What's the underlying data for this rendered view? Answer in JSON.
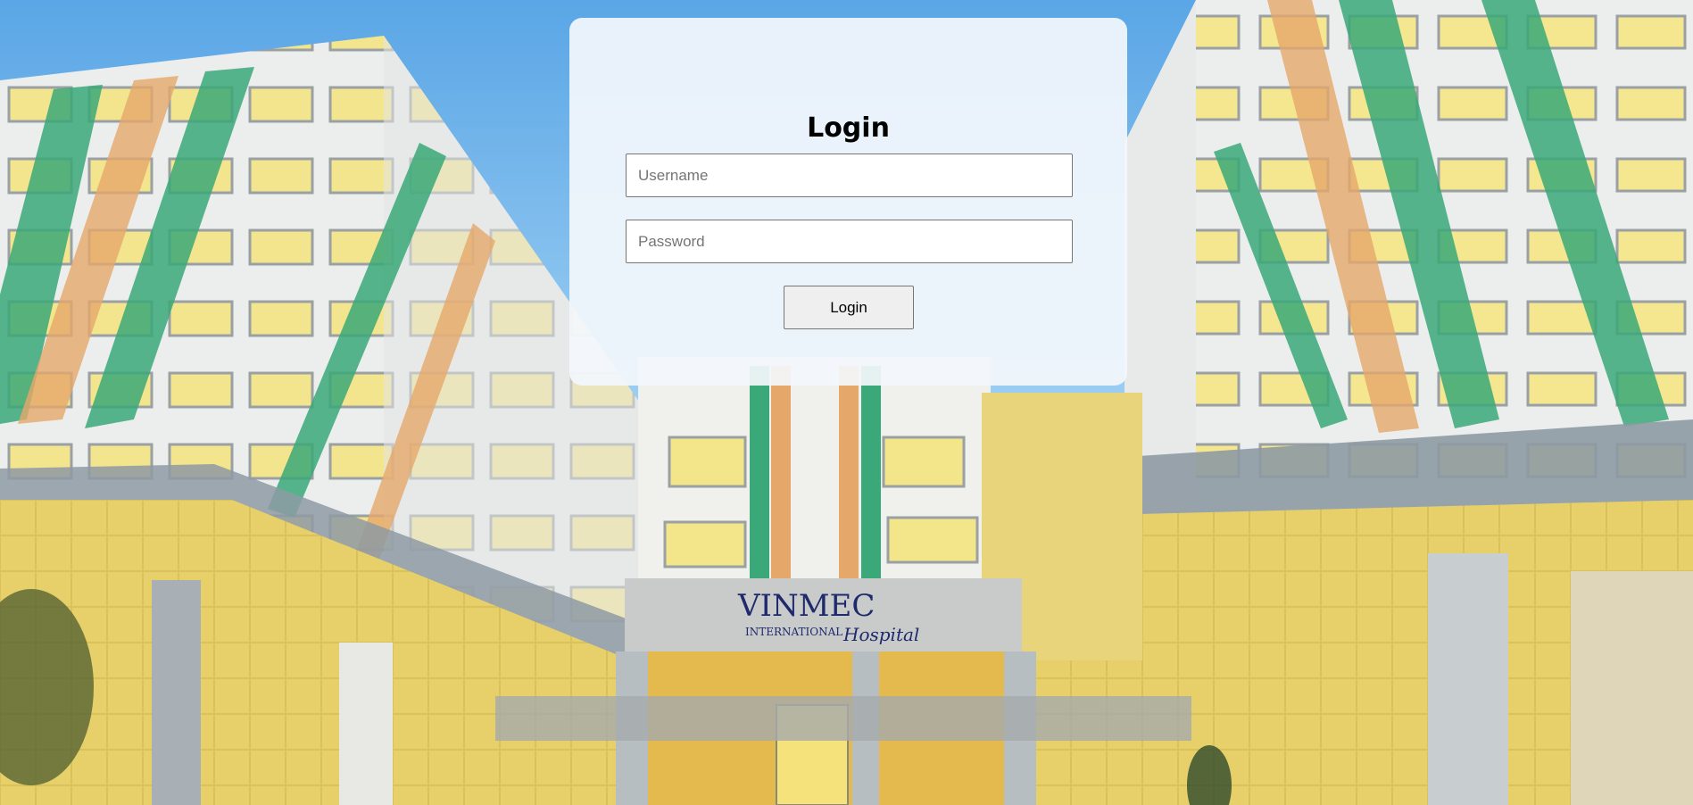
{
  "login": {
    "title": "Login",
    "username_placeholder": "Username",
    "password_placeholder": "Password",
    "button_label": "Login"
  },
  "background": {
    "sign_brand": "VINMEC",
    "sign_line1": "INTERNATIONAL",
    "sign_line2": "Hospital"
  },
  "colors": {
    "sky": "#6fb4ea",
    "building_wall": "#eef0f0",
    "accent_green": "#3aa878",
    "accent_orange": "#e6a76a",
    "window_glow": "#f6e98a",
    "brand_navy": "#1e2a6b"
  }
}
